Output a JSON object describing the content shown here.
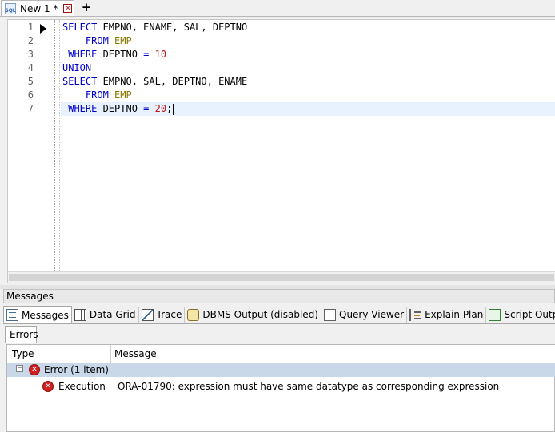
{
  "tabs": [
    {
      "label": "New 1 *",
      "icon": "sql-file-icon",
      "icon_text": "SQL"
    }
  ],
  "editor": {
    "line_numbers": [
      "1",
      "2",
      "3",
      "4",
      "5",
      "6",
      "7"
    ],
    "lines": [
      [
        {
          "t": "kw",
          "v": "SELECT"
        },
        {
          "t": "pl",
          "v": " EMPNO, ENAME, SAL, DEPTNO"
        }
      ],
      [
        {
          "t": "pl",
          "v": "    "
        },
        {
          "t": "kw",
          "v": "FROM"
        },
        {
          "t": "pl",
          "v": " "
        },
        {
          "t": "tb",
          "v": "EMP"
        }
      ],
      [
        {
          "t": "pl",
          "v": " "
        },
        {
          "t": "kw",
          "v": "WHERE"
        },
        {
          "t": "pl",
          "v": " DEPTNO "
        },
        {
          "t": "kw",
          "v": "="
        },
        {
          "t": "pl",
          "v": " "
        },
        {
          "t": "num",
          "v": "10"
        }
      ],
      [
        {
          "t": "kw",
          "v": "UNION"
        }
      ],
      [
        {
          "t": "kw",
          "v": "SELECT"
        },
        {
          "t": "pl",
          "v": " EMPNO, SAL, DEPTNO, ENAME"
        }
      ],
      [
        {
          "t": "pl",
          "v": "    "
        },
        {
          "t": "kw",
          "v": "FROM"
        },
        {
          "t": "pl",
          "v": " "
        },
        {
          "t": "tb",
          "v": "EMP"
        }
      ],
      [
        {
          "t": "pl",
          "v": " "
        },
        {
          "t": "kw",
          "v": "WHERE"
        },
        {
          "t": "pl",
          "v": " DEPTNO "
        },
        {
          "t": "kw",
          "v": "="
        },
        {
          "t": "pl",
          "v": " "
        },
        {
          "t": "num",
          "v": "20"
        },
        {
          "t": "pl",
          "v": ";"
        }
      ]
    ],
    "active_line": 7
  },
  "messages_panel": {
    "title": "Messages",
    "tabs": [
      {
        "label": "Messages",
        "icon": "messages-icon",
        "active": true
      },
      {
        "label": "Data Grid",
        "icon": "data-grid-icon"
      },
      {
        "label": "Trace",
        "icon": "trace-icon"
      },
      {
        "label": "DBMS Output (disabled)",
        "icon": "dbms-output-icon"
      },
      {
        "label": "Query Viewer",
        "icon": "query-viewer-icon"
      },
      {
        "label": "Explain Plan",
        "icon": "explain-plan-icon"
      },
      {
        "label": "Script Output",
        "icon": "script-output-icon"
      }
    ],
    "sub_tab": "Errors",
    "columns": {
      "type": "Type",
      "message": "Message"
    },
    "group": {
      "label": "Error (1 item)",
      "expander": "−"
    },
    "rows": [
      {
        "type": "Execution",
        "message": "ORA-01790: expression must have same datatype as corresponding expression"
      }
    ]
  },
  "colors": {
    "keyword": "#0000cc",
    "table": "#8c7a00",
    "number": "#c01010",
    "error": "#d02020",
    "group_row": "#c8d8e8"
  }
}
